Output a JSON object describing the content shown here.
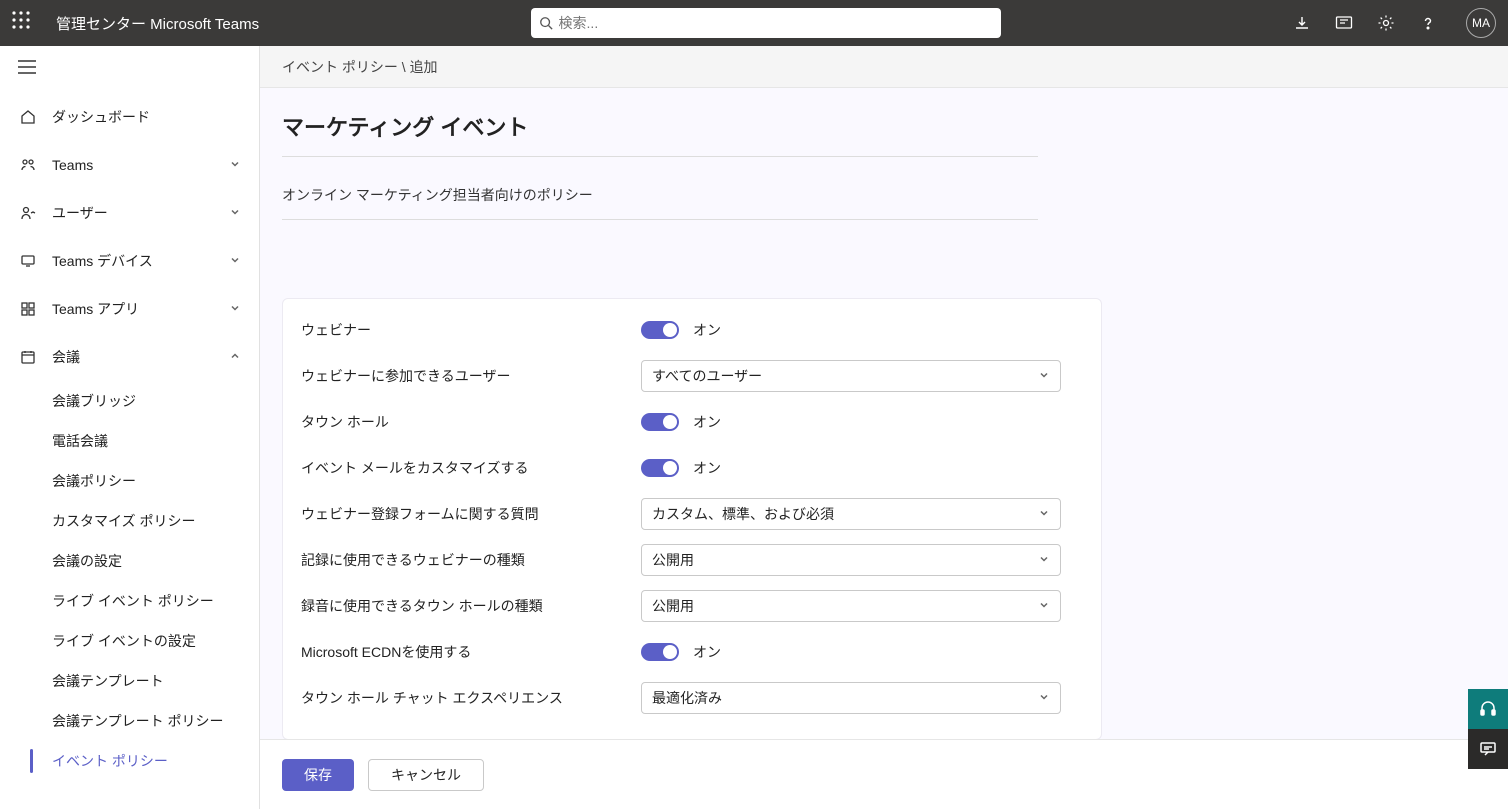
{
  "header": {
    "app_title": "管理センター Microsoft Teams",
    "search_placeholder": "検索...",
    "avatar_initials": "MA"
  },
  "sidebar": {
    "items": [
      {
        "label": "ダッシュボード",
        "icon": "home",
        "expandable": false
      },
      {
        "label": "Teams",
        "icon": "teams",
        "expandable": true
      },
      {
        "label": "ユーザー",
        "icon": "user",
        "expandable": true
      },
      {
        "label": "Teams デバイス",
        "icon": "device",
        "expandable": true
      },
      {
        "label": "Teams アプリ",
        "icon": "apps",
        "expandable": true
      },
      {
        "label": "会議",
        "icon": "calendar",
        "expandable": true,
        "expanded": true
      }
    ],
    "sub_items": [
      {
        "label": "会議ブリッジ"
      },
      {
        "label": "電話会議"
      },
      {
        "label": "会議ポリシー"
      },
      {
        "label": "カスタマイズ ポリシー"
      },
      {
        "label": "会議の設定"
      },
      {
        "label": "ライブ イベント ポリシー"
      },
      {
        "label": "ライブ イベントの設定"
      },
      {
        "label": "会議テンプレート"
      },
      {
        "label": "会議テンプレート ポリシー"
      },
      {
        "label": "イベント ポリシー",
        "active": true
      }
    ]
  },
  "breadcrumb": {
    "parent": "イベント ポリシー",
    "sep": " \\ ",
    "current": "追加"
  },
  "page": {
    "title": "マーケティング イベント",
    "description": "オンライン マーケティング担当者向けのポリシー"
  },
  "form": {
    "rows": [
      {
        "type": "toggle",
        "label": "ウェビナー",
        "value_label": "オン"
      },
      {
        "type": "select",
        "label": "ウェビナーに参加できるユーザー",
        "value": "すべてのユーザー"
      },
      {
        "type": "toggle",
        "label": "タウン ホール",
        "value_label": "オン"
      },
      {
        "type": "toggle",
        "label": "イベント メールをカスタマイズする",
        "value_label": "オン"
      },
      {
        "type": "select",
        "label": "ウェビナー登録フォームに関する質問",
        "value": "カスタム、標準、および必須"
      },
      {
        "type": "select",
        "label": "記録に使用できるウェビナーの種類",
        "value": "公開用"
      },
      {
        "type": "select",
        "label": "録音に使用できるタウン ホールの種類",
        "value": "公開用"
      },
      {
        "type": "toggle",
        "label": "Microsoft ECDNを使用する",
        "value_label": "オン"
      },
      {
        "type": "select",
        "label": "タウン ホール チャット エクスペリエンス",
        "value": "最適化済み"
      }
    ]
  },
  "footer": {
    "save": "保存",
    "cancel": "キャンセル"
  }
}
